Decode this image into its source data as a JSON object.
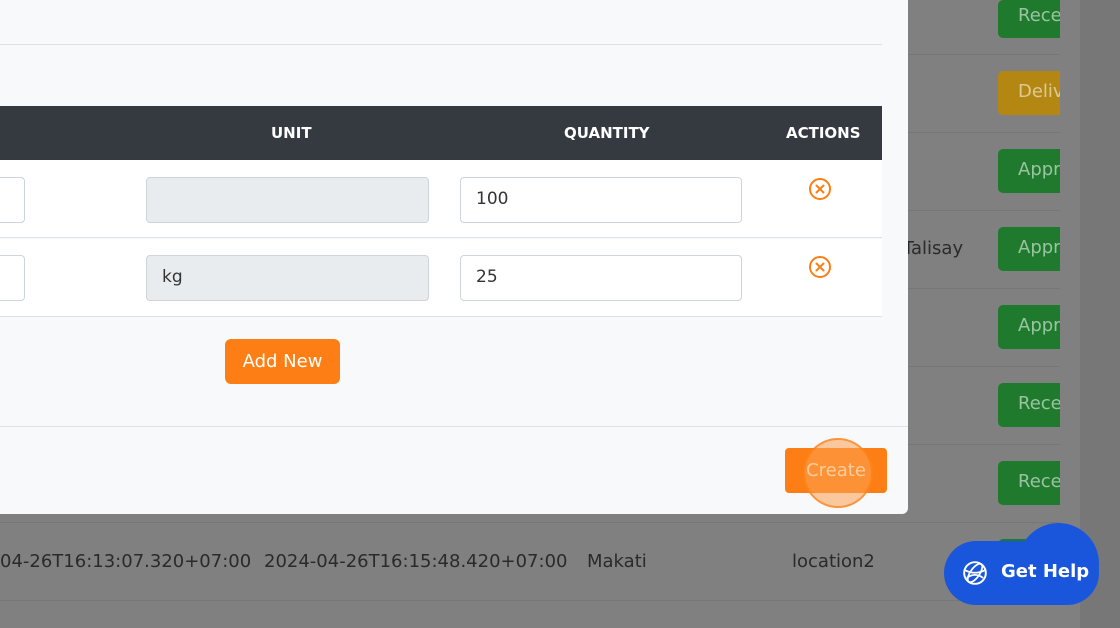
{
  "background_table": {
    "rows": [
      {
        "status": "Rece",
        "color": "green"
      },
      {
        "status": "Deliv",
        "color": "yellow"
      },
      {
        "status": "Appr",
        "color": "green"
      },
      {
        "status": "Appr",
        "color": "green",
        "location": "Talisay"
      },
      {
        "status": "Appr",
        "color": "green"
      },
      {
        "status": "Rece",
        "color": "green"
      },
      {
        "status": "Rece",
        "color": "green"
      }
    ],
    "bottom_row": {
      "created": "04-26T16:13:07.320+07:00",
      "updated": "2024-04-26T16:15:48.420+07:00",
      "city": "Makati",
      "location": "location2"
    }
  },
  "modal": {
    "table": {
      "headers": {
        "unit": "UNIT",
        "quantity": "QUANTITY",
        "actions": "ACTIONS"
      },
      "rows": [
        {
          "unit": "",
          "quantity": "100"
        },
        {
          "unit": "kg",
          "quantity": "25"
        }
      ]
    },
    "add_new_label": "Add New",
    "create_label": "Create"
  },
  "help": {
    "label": "Get Help",
    "icon": "globe-icon"
  },
  "colors": {
    "accent": "#fd7e14",
    "header": "#343a40",
    "help": "#1a56db",
    "success": "#28a745",
    "warning": "#ffc107"
  }
}
